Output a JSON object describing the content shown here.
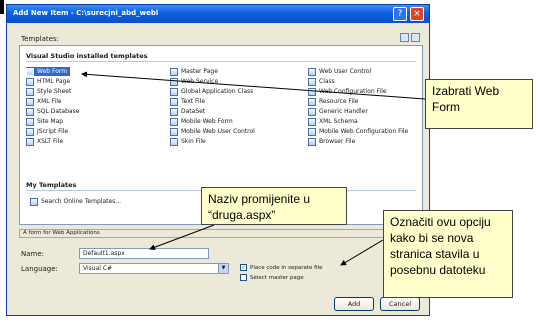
{
  "dialog": {
    "title": "Add New Item - C:\\surecjni_abd_webl",
    "help_glyph": "?",
    "close_glyph": "×"
  },
  "templates": {
    "label": "Templates:",
    "installed_heading": "Visual Studio installed templates",
    "installed": [
      {
        "label": "Web Form",
        "icon": "web-form-icon",
        "selected": true
      },
      {
        "label": "HTML Page",
        "icon": "html-page-icon"
      },
      {
        "label": "Style Sheet",
        "icon": "style-sheet-icon"
      },
      {
        "label": "XML File",
        "icon": "xml-file-icon"
      },
      {
        "label": "SQL Database",
        "icon": "sql-database-icon"
      },
      {
        "label": "Site Map",
        "icon": "site-map-icon"
      },
      {
        "label": "JScript File",
        "icon": "jscript-file-icon"
      },
      {
        "label": "XSLT File",
        "icon": "xslt-file-icon"
      },
      {
        "label": "Master Page",
        "icon": "master-page-icon"
      },
      {
        "label": "Web Service",
        "icon": "web-service-icon"
      },
      {
        "label": "Global Application Class",
        "icon": "global-application-class-icon"
      },
      {
        "label": "Text File",
        "icon": "text-file-icon"
      },
      {
        "label": "DataSet",
        "icon": "dataset-icon"
      },
      {
        "label": "Mobile Web Form",
        "icon": "mobile-web-form-icon"
      },
      {
        "label": "Mobile Web User Control",
        "icon": "mobile-web-user-control-icon"
      },
      {
        "label": "Skin File",
        "icon": "skin-file-icon"
      },
      {
        "label": "Web User Control",
        "icon": "web-user-control-icon"
      },
      {
        "label": "Class",
        "icon": "class-icon"
      },
      {
        "label": "Web Configuration File",
        "icon": "web-configuration-file-icon"
      },
      {
        "label": "Resource File",
        "icon": "resource-file-icon"
      },
      {
        "label": "Generic Handler",
        "icon": "generic-handler-icon"
      },
      {
        "label": "XML Schema",
        "icon": "xml-schema-icon"
      },
      {
        "label": "Mobile Web Configuration File",
        "icon": "mobile-web-configuration-file-icon"
      },
      {
        "label": "Browser File",
        "icon": "browser-file-icon"
      }
    ],
    "my_heading": "My Templates",
    "search_online": "Search Online Templates..."
  },
  "description": "A form for Web Applications",
  "form": {
    "name_label": "Name:",
    "name_value": "Default1.aspx",
    "language_label": "Language:",
    "language_value": "Visual C#",
    "separate_file_label": "Place code in separate file",
    "separate_file_checked": true,
    "master_page_label": "Select master page",
    "master_page_checked": false
  },
  "buttons": {
    "add": "Add",
    "cancel": "Cancel"
  },
  "callouts": {
    "web_form": "Izabrati Web Form",
    "rename": "Naziv promijenite u “druga.aspx”",
    "separate_file": "Označiti ovu opciju kako bi se nova stranica stavila u posebnu datoteku"
  },
  "colors": {
    "titlebar": "#0f5fe0",
    "selection": "#316ac5",
    "callout_fill": "#ffffcc",
    "dialog_face": "#ece9d8"
  }
}
